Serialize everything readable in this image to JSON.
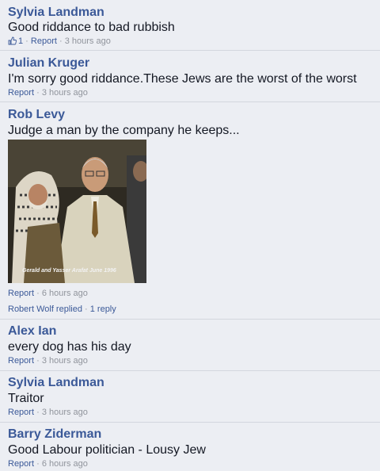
{
  "comments": [
    {
      "author": "Sylvia Landman",
      "text": "Good riddance to bad rubbish",
      "like_count": "1",
      "report_label": "Report",
      "time": "3 hours ago"
    },
    {
      "author": "Julian Kruger",
      "text": "I'm sorry good riddance.These Jews are the worst of the worst",
      "report_label": "Report",
      "time": "3 hours ago"
    },
    {
      "author": "Rob Levy",
      "text": "Judge a man by the company he keeps...",
      "photo_caption": "Gerald and Yasser Arafat June 1996",
      "report_label": "Report",
      "time": "6 hours ago",
      "reply_author": "Robert Wolf replied",
      "reply_count": "1 reply"
    },
    {
      "author": "Alex Ian",
      "text": "every dog has his day",
      "report_label": "Report",
      "time": "3 hours ago"
    },
    {
      "author": "Sylvia Landman",
      "text": "Traitor",
      "report_label": "Report",
      "time": "3 hours ago"
    },
    {
      "author": "Barry Ziderman",
      "text": "Good Labour politician - Lousy Jew",
      "report_label": "Report",
      "time": "6 hours ago"
    }
  ],
  "separator": " · ",
  "colors": {
    "author": "#3b5998",
    "body_text": "#141823",
    "meta": "#90949c",
    "background": "#eceef3",
    "divider": "#d3d6de"
  },
  "icons": {
    "like": "thumbs-up-icon"
  }
}
